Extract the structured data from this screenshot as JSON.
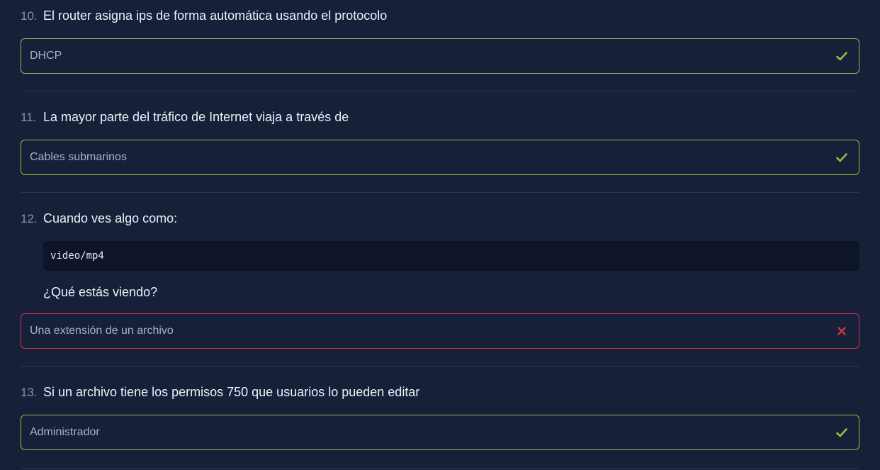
{
  "questions": [
    {
      "number": "10.",
      "text": "El router asigna ips de forma automática usando el protocolo",
      "answer": "DHCP",
      "status": "correct"
    },
    {
      "number": "11.",
      "text": "La mayor parte del tráfico de Internet viaja a través de",
      "answer": "Cables submarinos",
      "status": "correct"
    },
    {
      "number": "12.",
      "text": "Cuando ves algo como:",
      "code": "video/mp4",
      "subtext": "¿Qué estás viendo?",
      "answer": "Una extensión de un archivo",
      "status": "incorrect"
    },
    {
      "number": "13.",
      "text": "Si un archivo tiene los permisos 750 que usuarios lo pueden editar",
      "answer": "Administrador",
      "status": "correct"
    }
  ],
  "colors": {
    "background": "#172039",
    "correct": "#8fc140",
    "incorrect": "#d2353f",
    "code_background": "#0e1529",
    "divider": "#2b3550"
  },
  "icons": {
    "correct": "check-icon",
    "incorrect": "close-icon"
  }
}
